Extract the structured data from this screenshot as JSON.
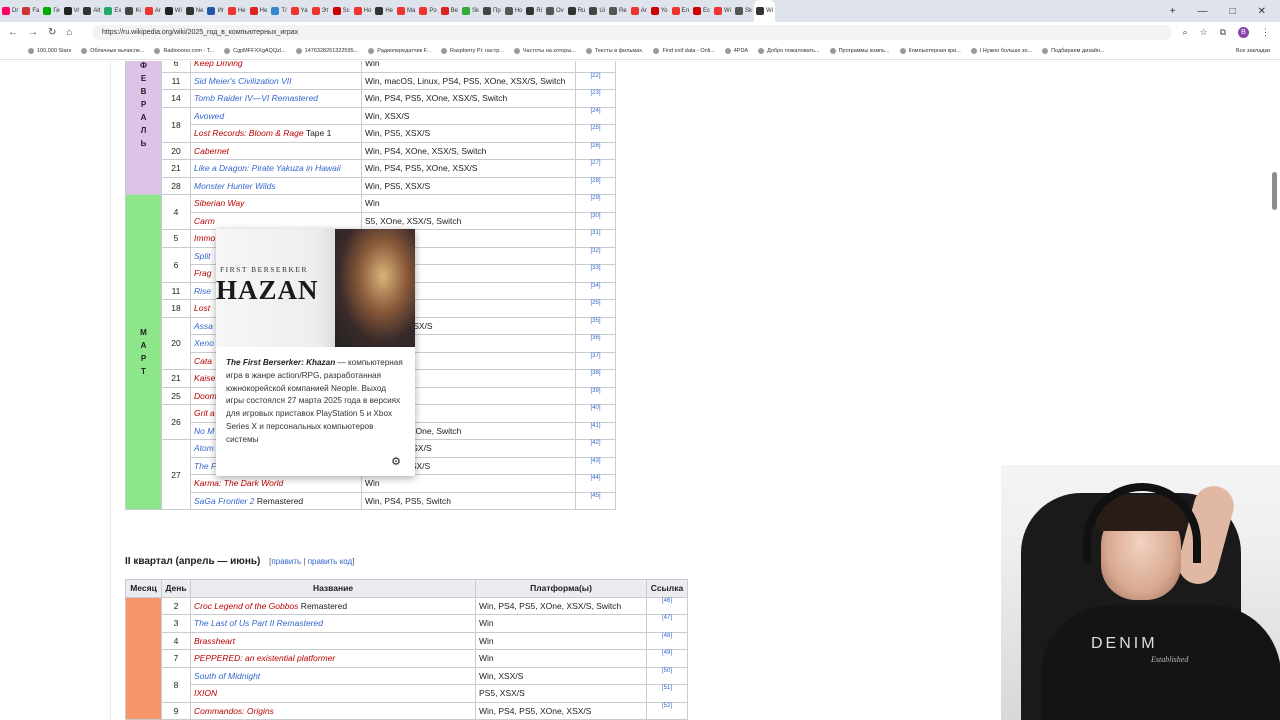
{
  "browser": {
    "tabs": [
      "Dr",
      "Fa",
      "Ги",
      "Vr",
      "Alt",
      "Ex",
      "Ki",
      "Ar",
      "Wi",
      "Ne",
      "Иг",
      "He",
      "He",
      "Т/",
      "Ya",
      "Эт",
      "Sc",
      "Ho",
      "He",
      "Ma",
      "Po",
      "Ве",
      "Sk",
      "Пр",
      "Ho",
      "Ri",
      "Ov",
      "Ru",
      "Ui",
      "Re",
      "Ar",
      "Yo",
      "Ел",
      "Ec",
      "Wi",
      "Sk",
      "Wi"
    ],
    "tab_colors": [
      "#f06",
      "#c33",
      "#0a0",
      "#222",
      "#333",
      "#2a6",
      "#444",
      "#e33",
      "#222",
      "#333",
      "#2255aa",
      "#e33",
      "#d22",
      "#38c",
      "#e33",
      "#e33",
      "#c00",
      "#e33",
      "#333",
      "#e33",
      "#e33",
      "#d22",
      "#3a3",
      "#444",
      "#555",
      "#333",
      "#555",
      "#333",
      "#444",
      "#555",
      "#e33",
      "#c00",
      "#e33",
      "#c00",
      "#e33",
      "#555",
      "#333"
    ],
    "active_tab": "Wi",
    "url": "https://ru.wikipedia.org/wiki/2025_год_в_компьютерных_играх",
    "bookmarks": [
      "100,000 Stars",
      "Облачные вычисле...",
      "Radiooooo.com - T...",
      "CgpMFFXXgAQQzl...",
      "1476328261322595...",
      "Радиопередатчик F...",
      "Raspberry Pi: настр...",
      "Частоты на которы...",
      "Тексты в фильмах.",
      "Find exif data - Onli...",
      "4PDA",
      "Добро пожаловать...",
      "Программы компь...",
      "Компьютерная кри...",
      "I Нужно больше зо...",
      "Подбираем дизайн..."
    ],
    "all_bookmarks": "Все закладки",
    "profile_letter": "B"
  },
  "q1_table": {
    "month_feb": "ФЕВРАЛЬ",
    "month_mar": "МАРТ",
    "rows": [
      {
        "day": "6",
        "title": "Keep Driving",
        "suffix": "",
        "platform": "Win",
        "ref": "[21]",
        "red": true
      },
      {
        "day": "11",
        "title": "Sid Meier's Civilization VII",
        "suffix": "",
        "platform": "Win, macOS, Linux, PS4, PS5, XOne, XSX/S, Switch",
        "ref": "[22]",
        "red": false
      },
      {
        "day": "14",
        "title": "Tomb Raider IV—VI Remastered",
        "suffix": "",
        "platform": "Win, PS4, PS5, XOne, XSX/S, Switch",
        "ref": "[23]",
        "red": false
      },
      {
        "day": "18",
        "title": "Avowed",
        "suffix": "",
        "platform": "Win, XSX/S",
        "ref": "[24]",
        "red": false
      },
      {
        "day": "",
        "title": "Lost Records: Bloom & Rage",
        "suffix": " Tape 1",
        "platform": "Win, PS5, XSX/S",
        "ref": "[25]",
        "red": true
      },
      {
        "day": "20",
        "title": "Cabernet",
        "suffix": "",
        "platform": "Win, PS4, XOne, XSX/S, Switch",
        "ref": "[26]",
        "red": true
      },
      {
        "day": "21",
        "title": "Like a Dragon: Pirate Yakuza in Hawaii",
        "suffix": "",
        "platform": "Win, PS4, PS5, XOne, XSX/S",
        "ref": "[27]",
        "red": false
      },
      {
        "day": "28",
        "title": "Monster Hunter Wilds",
        "suffix": "",
        "platform": "Win, PS5, XSX/S",
        "ref": "[28]",
        "red": false
      },
      {
        "day": "4",
        "title": "Siberian Way",
        "suffix": "",
        "platform": "Win",
        "ref": "[29]",
        "red": true
      },
      {
        "day": "",
        "title": "Carm",
        "suffix": "",
        "platform": "S5, XOne, XSX/S, Switch",
        "ref": "[30]",
        "red": true
      },
      {
        "day": "5",
        "title": "Immo",
        "suffix": "",
        "platform": "",
        "ref": "[31]",
        "red": true
      },
      {
        "day": "6",
        "title": "Split",
        "suffix": "",
        "platform": "S/S",
        "ref": "[32]",
        "red": false
      },
      {
        "day": "",
        "title": "Frag",
        "suffix": "",
        "platform": "",
        "ref": "[33]",
        "red": true
      },
      {
        "day": "11",
        "title": "Rise",
        "suffix": "",
        "platform": "",
        "ref": "[34]",
        "red": false
      },
      {
        "day": "18",
        "title": "Lost",
        "suffix": "",
        "platform": "S/S",
        "ref": "[25]",
        "red": true
      },
      {
        "day": "20",
        "title": "Assa",
        "suffix": "",
        "platform": "iPad, PS5, XSX/S",
        "ref": "[35]",
        "red": false
      },
      {
        "day": "",
        "title": "Xeno",
        "suffix": "",
        "platform": "",
        "ref": "[36]",
        "red": false
      },
      {
        "day": "",
        "title": "Cata",
        "suffix": "",
        "platform": "",
        "ref": "[37]",
        "red": true
      },
      {
        "day": "21",
        "title": "Kaise",
        "suffix": "",
        "platform": "",
        "ref": "[38]",
        "red": true
      },
      {
        "day": "25",
        "title": "Doom",
        "suffix": "",
        "platform": "",
        "ref": "[39]",
        "red": true
      },
      {
        "day": "26",
        "title": "Grit a",
        "suffix": "",
        "platform": "",
        "ref": "[40]",
        "red": true
      },
      {
        "day": "",
        "title": "No M",
        "suffix": "",
        "platform": "S4, XSX/S, XOne, Switch",
        "ref": "[41]",
        "red": false
      },
      {
        "day": "27",
        "title": "Atom",
        "suffix": "",
        "platform": "S5, XOne, XSX/S",
        "ref": "[42]",
        "red": false
      },
      {
        "day": "",
        "title": "The First Berserker: Khazan",
        "suffix": "",
        "platform": "Win, PS5, XSX/S",
        "ref": "[43]",
        "red": false
      },
      {
        "day": "",
        "title": "Karma: The Dark World",
        "suffix": "",
        "platform": "Win",
        "ref": "[44]",
        "red": true
      },
      {
        "day": "",
        "title": "SaGa Frontier 2",
        "suffix": " Remastered",
        "platform": "Win, PS4, PS5, Switch",
        "ref": "[45]",
        "red": false
      }
    ]
  },
  "section": {
    "title": "II квартал (апрель — июнь)",
    "edit_open": "[",
    "edit": "править",
    "sep": " | ",
    "edit_code": "править код",
    "edit_close": "]"
  },
  "q2_table": {
    "headers": {
      "month": "Месяц",
      "day": "День",
      "name": "Название",
      "platform": "Платформа(ы)",
      "ref": "Ссылка"
    },
    "rows": [
      {
        "day": "2",
        "title": "Croc Legend of the Gobbos",
        "suffix": " Remastered",
        "platform": "Win, PS4, PS5, XOne, XSX/S, Switch",
        "ref": "[46]",
        "red": true
      },
      {
        "day": "3",
        "title": "The Last of Us Part II Remastered",
        "suffix": "",
        "platform": "Win",
        "ref": "[47]",
        "red": false
      },
      {
        "day": "4",
        "title": "Brassheart",
        "suffix": "",
        "platform": "Win",
        "ref": "[48]",
        "red": true
      },
      {
        "day": "7",
        "title": "PEPPERED: an existential platformer",
        "suffix": "",
        "platform": "Win",
        "ref": "[49]",
        "red": true
      },
      {
        "day": "8",
        "title": "South of Midnight",
        "suffix": "",
        "platform": "Win, XSX/S",
        "ref": "[50]",
        "red": false
      },
      {
        "day": "",
        "title": "IXION",
        "suffix": "",
        "platform": "PS5, XSX/S",
        "ref": "[51]",
        "red": true
      },
      {
        "day": "9",
        "title": "Commandos: Origins",
        "suffix": "",
        "platform": "Win, PS4, PS5, XOne, XSX/S",
        "ref": "[52]",
        "red": true
      }
    ]
  },
  "popup": {
    "image_subtitle": "FIRST BERSERKER",
    "image_title": "HAZAN",
    "title": "The First Berserker: Khazan",
    "dash": " —",
    "text": "компьютерная игра в жанре action/RPG, разработанная южнокорейской компанией Neople. Выход игры состоялся 27 марта 2025 года в версиях для игровых приставок PlayStation 5 и Xbox Series X и персональных компьютеров системы",
    "gear": "⚙"
  },
  "webcam": {
    "shirt_logo": "DENIM",
    "shirt_logo_sub": "Established"
  },
  "colors": {
    "feb": "#dec3e8",
    "mar": "#8ee68a",
    "apr": "#f7956b",
    "link": "#3366cc",
    "redlink": "#ba0000"
  }
}
